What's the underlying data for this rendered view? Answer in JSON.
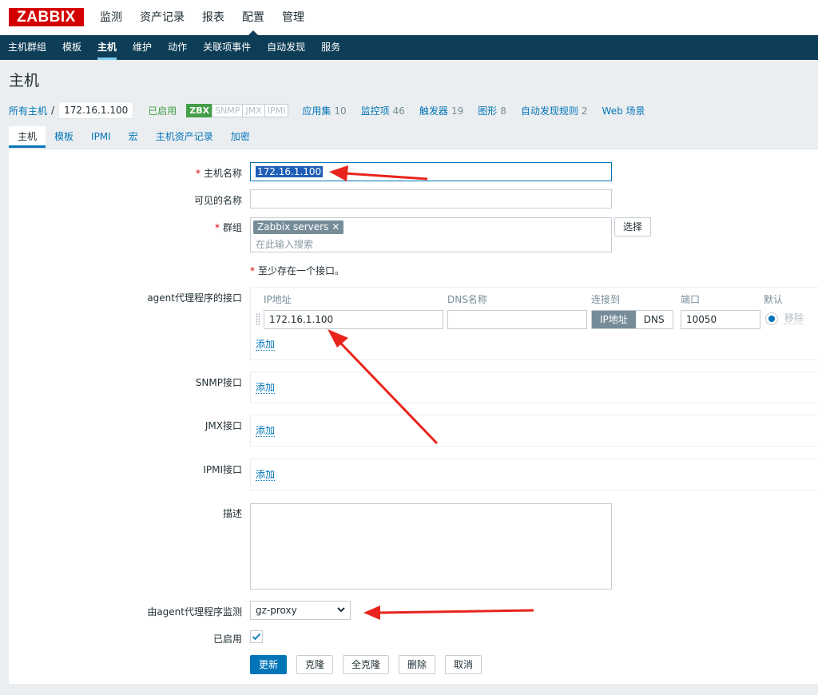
{
  "brand": {
    "logo_text": "ZABBIX",
    "color": "#d40000"
  },
  "top_menu": [
    {
      "label": "监测"
    },
    {
      "label": "资产记录"
    },
    {
      "label": "报表"
    },
    {
      "label": "配置",
      "active": true
    },
    {
      "label": "管理"
    }
  ],
  "sub_menu": [
    {
      "label": "主机群组"
    },
    {
      "label": "模板"
    },
    {
      "label": "主机",
      "active": true
    },
    {
      "label": "维护"
    },
    {
      "label": "动作"
    },
    {
      "label": "关联项事件"
    },
    {
      "label": "自动发现"
    },
    {
      "label": "服务"
    }
  ],
  "page_title": "主机",
  "breadcrumb": {
    "all_hosts": "所有主机",
    "separator": "/",
    "current_host": "172.16.1.100",
    "status": "已启用",
    "availability": [
      "ZBX",
      "SNMP",
      "JMX",
      "IPMI"
    ],
    "metrics": [
      {
        "label": "应用集",
        "count": "10"
      },
      {
        "label": "监控项",
        "count": "46"
      },
      {
        "label": "触发器",
        "count": "19"
      },
      {
        "label": "图形",
        "count": "8"
      },
      {
        "label": "自动发现规则",
        "count": "2"
      },
      {
        "label": "Web 场景",
        "count": ""
      }
    ]
  },
  "tabs": [
    {
      "label": "主机",
      "active": true
    },
    {
      "label": "模板"
    },
    {
      "label": "IPMI"
    },
    {
      "label": "宏"
    },
    {
      "label": "主机资产记录"
    },
    {
      "label": "加密"
    }
  ],
  "form": {
    "host_name_label": "主机名称",
    "host_name_value": "172.16.1.100",
    "visible_name_label": "可见的名称",
    "visible_name_value": "",
    "groups_label": "群组",
    "groups_chip": "Zabbix servers",
    "groups_chip_remove": "✕",
    "groups_placeholder": "在此输入搜索",
    "select_button": "选择",
    "interface_hint": "至少存在一个接口。",
    "agent_iface_label": "agent代理程序的接口",
    "iface_columns": {
      "ip": "IP地址",
      "dns": "DNS名称",
      "connect": "连接到",
      "port": "端口",
      "default": "默认"
    },
    "agent_iface": {
      "ip": "172.16.1.100",
      "dns": "",
      "connect_ip": "IP地址",
      "connect_dns": "DNS",
      "port": "10050",
      "remove": "移除"
    },
    "add_link": "添加",
    "snmp_label": "SNMP接口",
    "jmx_label": "JMX接口",
    "ipmi_label": "IPMI接口",
    "description_label": "描述",
    "description_value": "",
    "proxy_label": "由agent代理程序监测",
    "proxy_value": "gz-proxy",
    "enabled_label": "已启用",
    "enabled": true
  },
  "buttons": {
    "update": "更新",
    "clone": "克隆",
    "full_clone": "全克隆",
    "delete": "删除",
    "cancel": "取消"
  },
  "colors": {
    "nav_bg": "#0e3e57",
    "link": "#0275b8",
    "enabled_green": "#429e47",
    "arrow_red": "#e8241c"
  }
}
